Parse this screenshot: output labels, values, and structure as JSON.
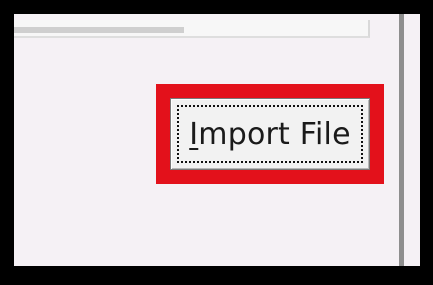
{
  "import_button": {
    "mnemonic": "I",
    "rest": "mport File"
  },
  "colors": {
    "highlight": "#e3111b",
    "frame": "#000000",
    "panel": "#f5f1f5"
  }
}
